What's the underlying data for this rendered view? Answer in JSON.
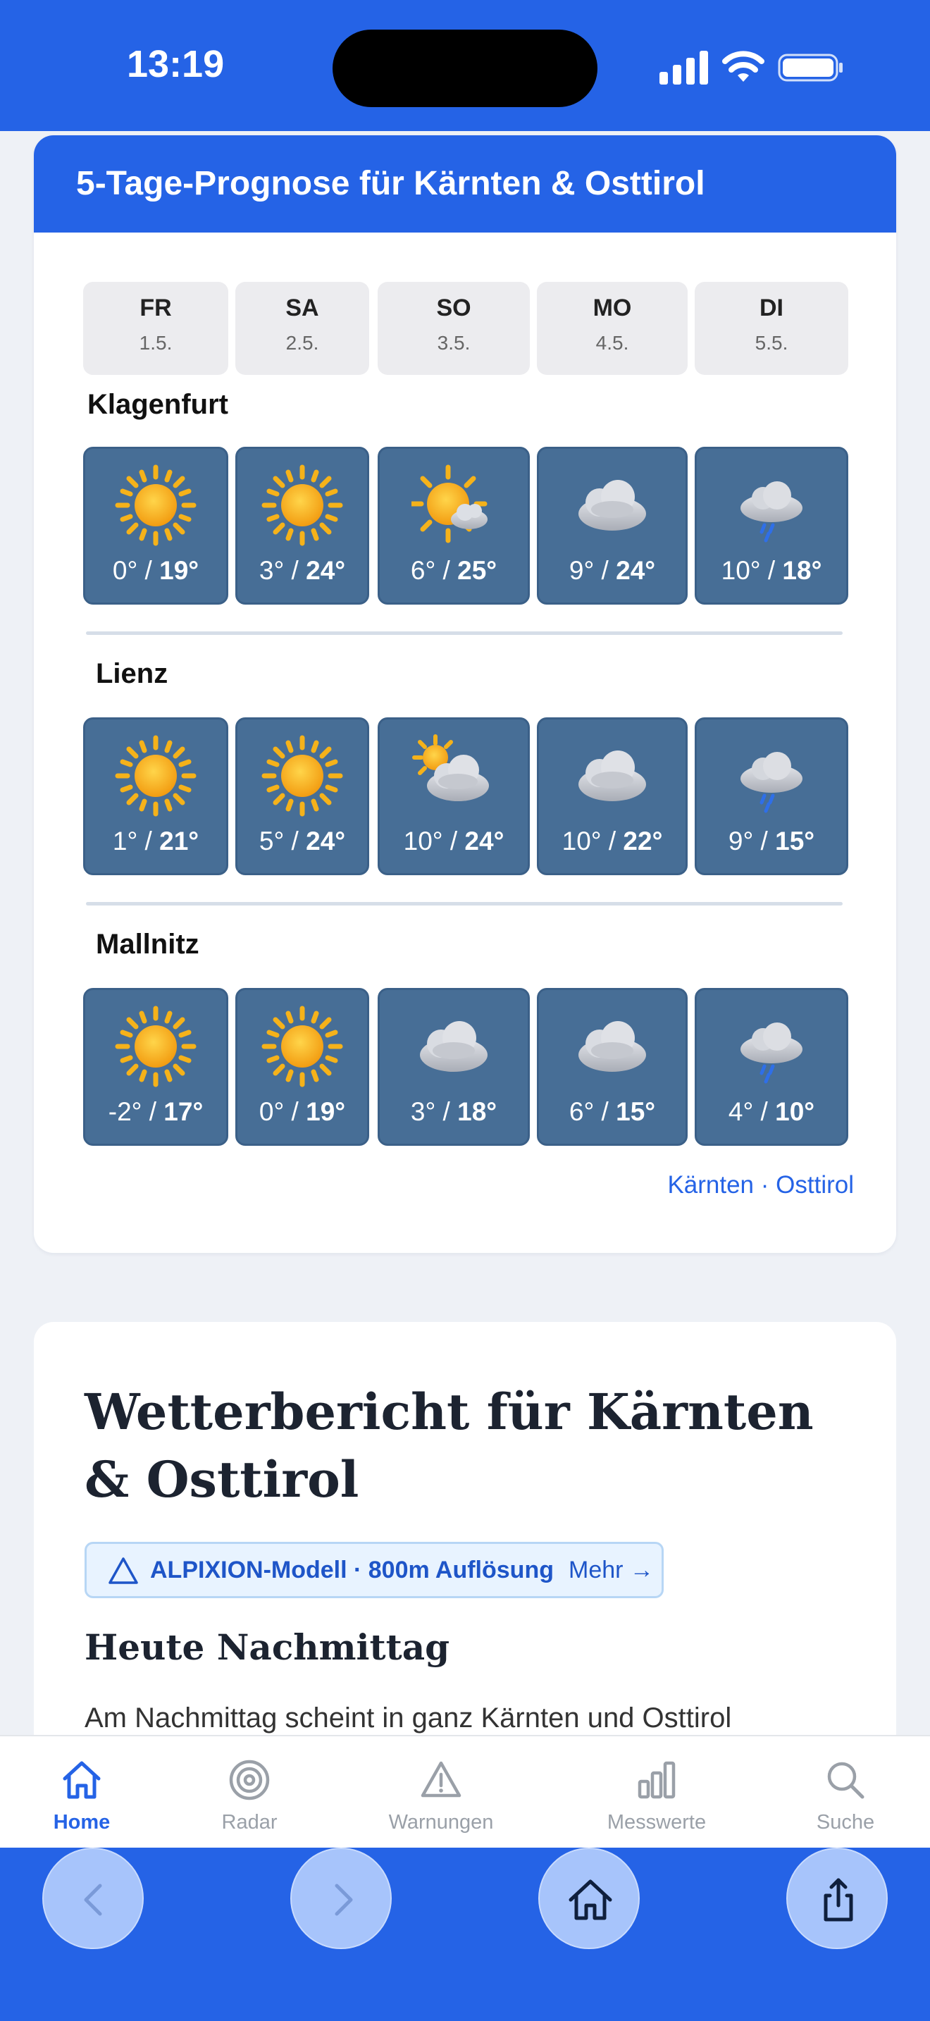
{
  "status_bar": {
    "time": "13:19"
  },
  "forecast": {
    "title": "5-Tage-Prognose für Kärnten & Osttirol",
    "days": [
      {
        "name": "FR",
        "date": "1.5."
      },
      {
        "name": "SA",
        "date": "2.5."
      },
      {
        "name": "SO",
        "date": "3.5."
      },
      {
        "name": "MO",
        "date": "4.5."
      },
      {
        "name": "DI",
        "date": "5.5."
      }
    ],
    "cities": [
      {
        "name": "Klagenfurt",
        "cells": [
          {
            "icon": "sun-icon",
            "low": "0°",
            "high": "19°"
          },
          {
            "icon": "sun-icon",
            "low": "3°",
            "high": "24°"
          },
          {
            "icon": "sun-small-cloud-icon",
            "low": "6°",
            "high": "25°"
          },
          {
            "icon": "cloud-icon",
            "low": "9°",
            "high": "24°"
          },
          {
            "icon": "rain-cloud-icon",
            "low": "10°",
            "high": "18°"
          }
        ]
      },
      {
        "name": "Lienz",
        "cells": [
          {
            "icon": "sun-icon",
            "low": "1°",
            "high": "21°"
          },
          {
            "icon": "sun-icon",
            "low": "5°",
            "high": "24°"
          },
          {
            "icon": "cloud-sun-icon",
            "low": "10°",
            "high": "24°"
          },
          {
            "icon": "cloud-icon",
            "low": "10°",
            "high": "22°"
          },
          {
            "icon": "rain-cloud-icon",
            "low": "9°",
            "high": "15°"
          }
        ]
      },
      {
        "name": "Mallnitz",
        "cells": [
          {
            "icon": "sun-icon",
            "low": "-2°",
            "high": "17°"
          },
          {
            "icon": "sun-icon",
            "low": "0°",
            "high": "19°"
          },
          {
            "icon": "cloud-icon",
            "low": "3°",
            "high": "18°"
          },
          {
            "icon": "cloud-icon",
            "low": "6°",
            "high": "15°"
          },
          {
            "icon": "rain-cloud-icon",
            "low": "4°",
            "high": "10°"
          }
        ]
      }
    ],
    "links": {
      "a": "Kärnten",
      "sep": " · ",
      "b": "Osttirol"
    }
  },
  "report": {
    "title": "Wetterbericht für Kärnten & Osttirol",
    "model_badge": {
      "text": "ALPIXION-Modell · 800m Auflösung",
      "more": "Mehr →"
    },
    "section_title": "Heute Nachmittag",
    "text": "Am Nachmittag scheint in ganz Kärnten und Osttirol"
  },
  "tabbar": [
    {
      "label": "Home",
      "icon": "home-icon",
      "active": true
    },
    {
      "label": "Radar",
      "icon": "radar-icon"
    },
    {
      "label": "Warnungen",
      "icon": "warning-icon"
    },
    {
      "label": "Messwerte",
      "icon": "bar-chart-icon"
    },
    {
      "label": "Suche",
      "icon": "search-icon"
    }
  ],
  "colors": {
    "accent": "#2563e6",
    "cell": "#476e96",
    "sun": "#f5b21a"
  }
}
